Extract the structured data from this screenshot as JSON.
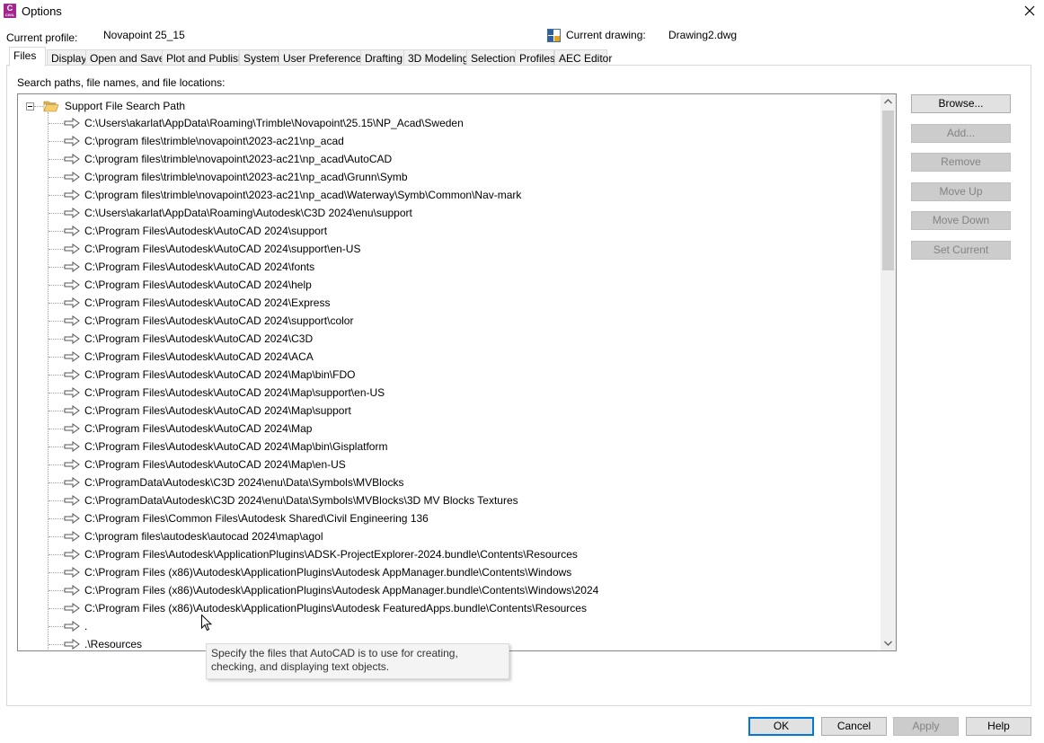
{
  "window": {
    "title": "Options",
    "app_icon_letter": "C",
    "app_icon_sub": "CIVIL"
  },
  "profile": {
    "current_profile_label": "Current profile:",
    "current_profile_value": "Novapoint 25_15",
    "current_drawing_label": "Current drawing:",
    "current_drawing_value": "Drawing2.dwg"
  },
  "tabs": [
    "Files",
    "Display",
    "Open and Save",
    "Plot and Publish",
    "System",
    "User Preferences",
    "Drafting",
    "3D Modeling",
    "Selection",
    "Profiles",
    "AEC Editor"
  ],
  "active_tab": "Files",
  "files": {
    "section_label": "Search paths, file names, and file locations:",
    "root_label": "Support File Search Path",
    "paths": [
      "C:\\Users\\akarlat\\AppData\\Roaming\\Trimble\\Novapoint\\25.15\\NP_Acad\\Sweden",
      "C:\\program files\\trimble\\novapoint\\2023-ac21\\np_acad",
      "C:\\program files\\trimble\\novapoint\\2023-ac21\\np_acad\\AutoCAD",
      "C:\\program files\\trimble\\novapoint\\2023-ac21\\np_acad\\Grunn\\Symb",
      "C:\\program files\\trimble\\novapoint\\2023-ac21\\np_acad\\Waterway\\Symb\\Common\\Nav-mark",
      "C:\\Users\\akarlat\\AppData\\Roaming\\Autodesk\\C3D 2024\\enu\\support",
      "C:\\Program Files\\Autodesk\\AutoCAD 2024\\support",
      "C:\\Program Files\\Autodesk\\AutoCAD 2024\\support\\en-US",
      "C:\\Program Files\\Autodesk\\AutoCAD 2024\\fonts",
      "C:\\Program Files\\Autodesk\\AutoCAD 2024\\help",
      "C:\\Program Files\\Autodesk\\AutoCAD 2024\\Express",
      "C:\\Program Files\\Autodesk\\AutoCAD 2024\\support\\color",
      "C:\\Program Files\\Autodesk\\AutoCAD 2024\\C3D",
      "C:\\Program Files\\Autodesk\\AutoCAD 2024\\ACA",
      "C:\\Program Files\\Autodesk\\AutoCAD 2024\\Map\\bin\\FDO",
      "C:\\Program Files\\Autodesk\\AutoCAD 2024\\Map\\support\\en-US",
      "C:\\Program Files\\Autodesk\\AutoCAD 2024\\Map\\support",
      "C:\\Program Files\\Autodesk\\AutoCAD 2024\\Map",
      "C:\\Program Files\\Autodesk\\AutoCAD 2024\\Map\\bin\\Gisplatform",
      "C:\\Program Files\\Autodesk\\AutoCAD 2024\\Map\\en-US",
      "C:\\ProgramData\\Autodesk\\C3D 2024\\enu\\Data\\Symbols\\MVBlocks",
      "C:\\ProgramData\\Autodesk\\C3D 2024\\enu\\Data\\Symbols\\MVBlocks\\3D MV Blocks Textures",
      "C:\\Program Files\\Common Files\\Autodesk Shared\\Civil Engineering 136",
      "C:\\program files\\autodesk\\autocad 2024\\map\\agol",
      "C:\\Program Files\\Autodesk\\ApplicationPlugins\\ADSK-ProjectExplorer-2024.bundle\\Contents\\Resources",
      "C:\\Program Files (x86)\\Autodesk\\ApplicationPlugins\\Autodesk AppManager.bundle\\Contents\\Windows",
      "C:\\Program Files (x86)\\Autodesk\\ApplicationPlugins\\Autodesk AppManager.bundle\\Contents\\Windows\\2024",
      "C:\\Program Files (x86)\\Autodesk\\ApplicationPlugins\\Autodesk FeaturedApps.bundle\\Contents\\Resources",
      ".",
      ".\\Resources"
    ]
  },
  "side_buttons": {
    "browse": "Browse...",
    "add": "Add...",
    "remove": "Remove",
    "move_up": "Move Up",
    "move_down": "Move Down",
    "set_current": "Set Current"
  },
  "tooltip": "Specify the files that AutoCAD is to use for creating, checking, and displaying text objects.",
  "footer": {
    "ok": "OK",
    "cancel": "Cancel",
    "apply": "Apply",
    "help": "Help"
  }
}
